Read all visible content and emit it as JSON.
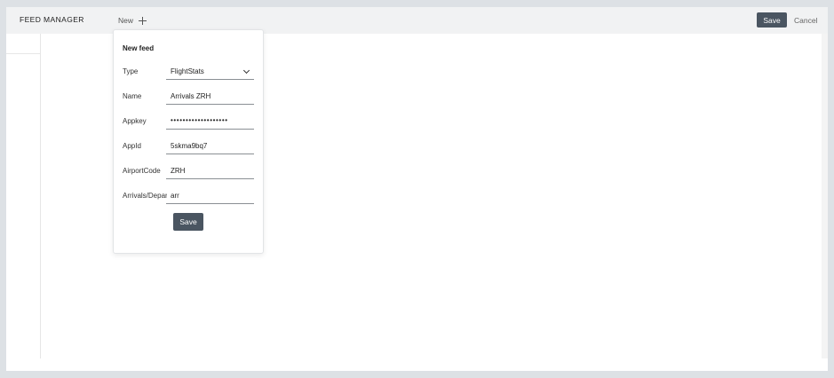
{
  "header": {
    "title": "FEED MANAGER",
    "new_label": "New",
    "save_label": "Save",
    "cancel_label": "Cancel"
  },
  "form": {
    "title": "New feed",
    "fields": [
      {
        "label": "Type",
        "value": "FlightStats",
        "kind": "select"
      },
      {
        "label": "Name",
        "value": "Arrivals ZRH",
        "kind": "text"
      },
      {
        "label": "Appkey",
        "value": "•••••••••••••••••••",
        "kind": "password"
      },
      {
        "label": "AppId",
        "value": "5skma9bq7",
        "kind": "text"
      },
      {
        "label": "AirportCode",
        "value": "ZRH",
        "kind": "text"
      },
      {
        "label": "Arrivals/Departures",
        "value": "arr",
        "kind": "text"
      }
    ],
    "save_label": "Save"
  },
  "colors": {
    "button_bg": "#4a5561",
    "page_bg": "#dde1e5",
    "topbar_bg": "#f1f2f3"
  },
  "icons": {
    "new": "plus-icon",
    "select": "chevron-down-icon"
  }
}
